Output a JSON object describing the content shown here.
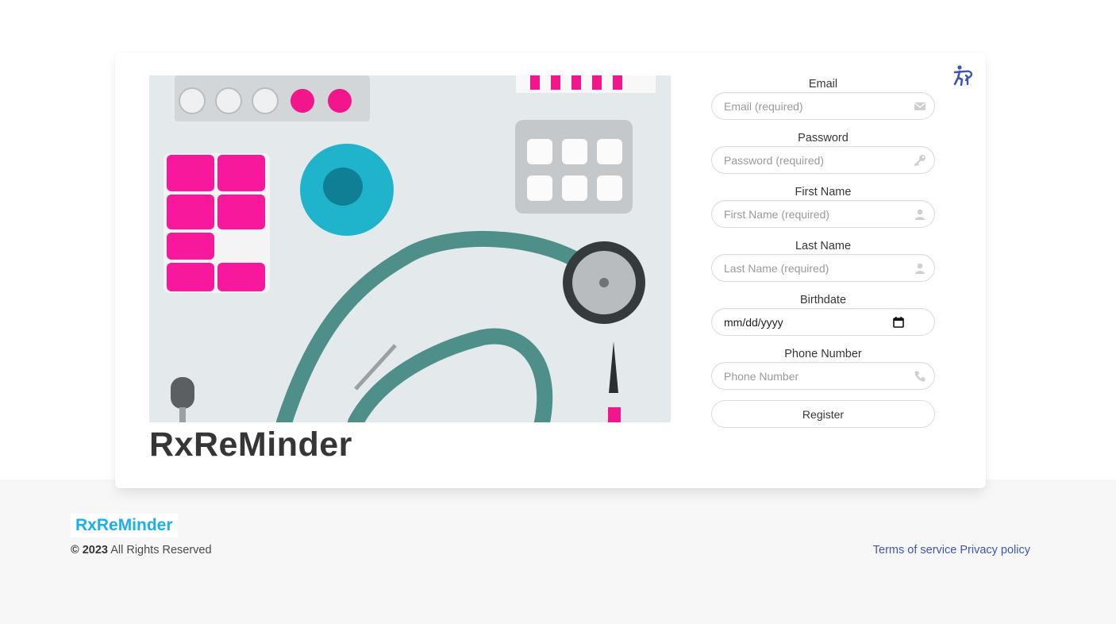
{
  "app": {
    "title": "RxReMinder"
  },
  "form": {
    "email": {
      "label": "Email",
      "placeholder": "Email (required)",
      "icon": "envelope-icon"
    },
    "password": {
      "label": "Password",
      "placeholder": "Password (required)",
      "icon": "key-icon"
    },
    "first_name": {
      "label": "First Name",
      "placeholder": "First Name (required)",
      "icon": "user-icon"
    },
    "last_name": {
      "label": "Last Name",
      "placeholder": "Last Name (required)",
      "icon": "user-icon"
    },
    "birthdate": {
      "label": "Birthdate",
      "value": "mm/dd/yyyy",
      "icon": "calendar-icon"
    },
    "phone": {
      "label": "Phone Number",
      "placeholder": "Phone Number",
      "icon": "phone-icon"
    },
    "register_label": "Register"
  },
  "accessibility": {
    "icon": "accessibility-icon",
    "color": "#3e56b3"
  },
  "footer": {
    "logo": "RxReMinder",
    "copyright_symbol": "©",
    "copyright_year": "2023",
    "copyright_text": "All Rights Reserved",
    "links": [
      "Terms of service",
      "Privacy policy"
    ]
  },
  "colors": {
    "brand": "#1ab0e8",
    "link": "#3e56b3"
  }
}
